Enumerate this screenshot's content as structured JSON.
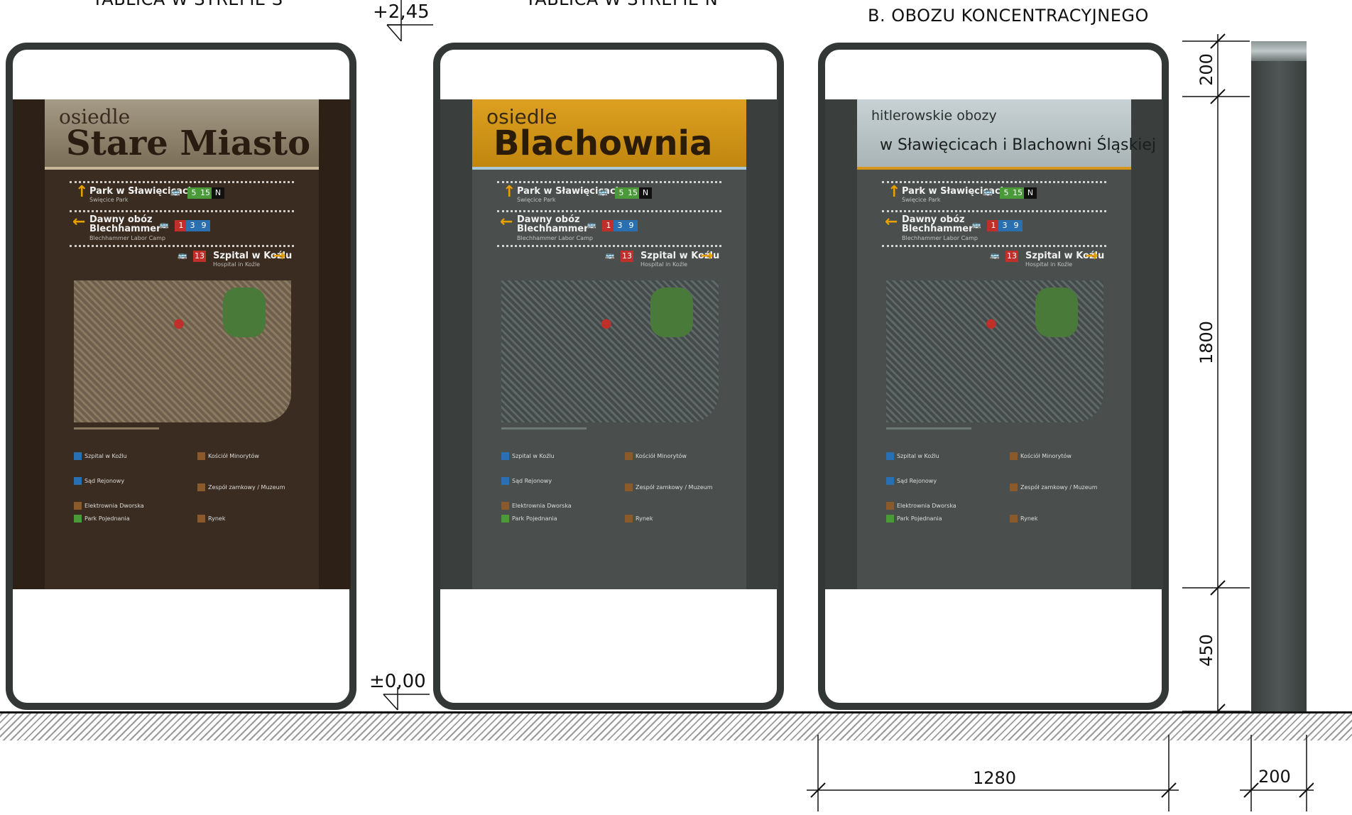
{
  "top_labels": {
    "left": "TABLICA W STREFIE S",
    "middle": "TABLICA W STREFIE N",
    "right": "B. OBOZU KONCENTRACYJNEGO"
  },
  "levels": {
    "top": "+2,45",
    "ground": "±0,00"
  },
  "dimensions": {
    "header_height": "200",
    "panel_height": "1800",
    "base_height": "450",
    "width": "1280",
    "depth": "200"
  },
  "signs": [
    {
      "header_small": "osiedle",
      "header_big": "Stare Miasto",
      "header_color": "#8a7e6a",
      "body_color": "#3a2c20"
    },
    {
      "header_small": "osiedle",
      "header_big": "Blachownia",
      "header_color": "#d4961a",
      "body_color": "#4a4e4d"
    },
    {
      "header_small": "hitlerowskie obozy",
      "header_big": "w Sławięcicach i Blachowni Śląskiej",
      "header_color": "#b9c4c6",
      "body_color": "#4a4e4d"
    }
  ],
  "directions": {
    "d1": {
      "name": "Park w Sławięcicach",
      "sub": "Święcice Park",
      "badges": [
        "5",
        "15",
        "N"
      ]
    },
    "d2": {
      "name": "Dawny obóz",
      "name2": "Blechhammer",
      "sub": "Blechhammer Labor Camp",
      "badges": [
        "1",
        "3",
        "9"
      ]
    },
    "d3": {
      "name": "Szpital w Koźlu",
      "sub": "Hospital in Koźle",
      "badges": [
        "13"
      ]
    }
  },
  "legend": {
    "l1": "Szpital w Koźlu",
    "l2": "Sąd Rejonowy",
    "l3": "Elektrownia Dworska",
    "l4": "Park Pojednania",
    "r1": "Kościół Minorytów",
    "r2": "Zespół zamkowy / Muzeum",
    "r3": "Rynek"
  },
  "colors": {
    "frame": "#333837",
    "badge_green": "#4a9a3a",
    "badge_red": "#c0302a",
    "badge_blue": "#2a70b0",
    "badge_black": "#111111",
    "arrow": "#e8a000",
    "ground_hatch": "#999999"
  }
}
